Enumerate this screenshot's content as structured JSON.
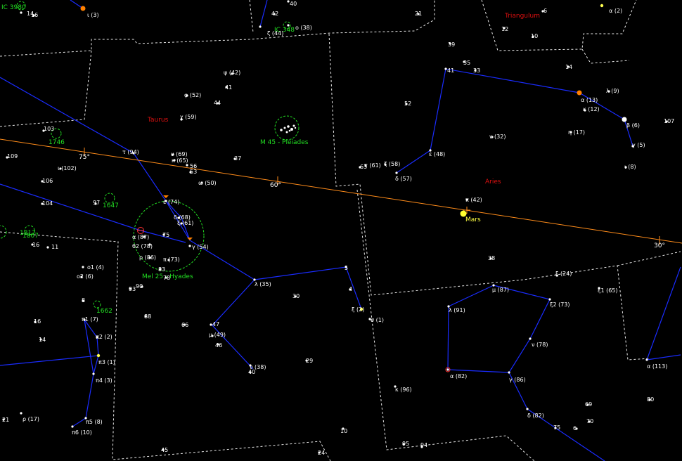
{
  "colors": {
    "background": "#000000",
    "constellation_line": "#1a2cff",
    "boundary": "#e8e8e8",
    "ecliptic": "#ff8c1a",
    "dso": "#22dd22",
    "constellation_name": "#e01010",
    "planet": "#ffff30",
    "star_label": "#ffffff"
  },
  "constellation_names": [
    "Taurus",
    "Aries",
    "Triangulum"
  ],
  "dso_labels": [
    "IC 348",
    "M 45 - Pleiades",
    "Mel 25 - Hyades",
    "1746",
    "1647",
    "1662",
    "1807",
    "1817",
    "IC 3980"
  ],
  "ecliptic_ticks": [
    "75°",
    "60°",
    "30°"
  ],
  "planet": {
    "name": "Mars",
    "icon": "planet-disc-icon"
  },
  "star_labels": [
    "ι (3)",
    "14",
    "16",
    "40",
    "42",
    "ζ (44)",
    "o (38)",
    "21",
    "6",
    "α (2)",
    "12",
    "10",
    "39",
    "35",
    "33",
    "41",
    "14",
    "ψ (42)",
    "41",
    "φ (52)",
    "44",
    "χ (59)",
    "52",
    "λ (9)",
    "α (13)",
    "κ (12)",
    "β (6)",
    "η (17)",
    "107",
    "γ (5)",
    "ι (8)",
    "ν (32)",
    "ε (48)",
    "ζ (58)",
    "τ (61)",
    "63",
    "δ (57)",
    "37",
    "υ (69)",
    "κ (65)",
    "56",
    "53",
    "ω (50)",
    "τ (94)",
    "103",
    "109",
    "ι (102)",
    "106",
    "104",
    "97",
    "π (42)",
    "ε (74)",
    "δ (68)",
    "ξ (61)",
    "75",
    "α (87)",
    "θ2 (78)",
    "γ (54)",
    "ρ (86)",
    "π (73)",
    "83",
    "78",
    "16",
    "11",
    "ο1 (4)",
    "ο2 (6)",
    "93",
    "90",
    "88",
    "66",
    "47",
    "μ (49)",
    "46",
    "λ (35)",
    "30",
    "5",
    "4",
    "ξ (2)",
    "σ (1)",
    "38",
    "ξ (24)",
    "μ (87)",
    "ξ2 (73)",
    "ξ1 (65)",
    "λ (91)",
    "ν (78)",
    "α (82)",
    "γ (86)",
    "δ (82)",
    "α (113)",
    "ν (38)",
    "40",
    "29",
    "κ (96)",
    "69",
    "70",
    "75",
    "80",
    "8",
    "16",
    "π1 (7)",
    "π2 (2)",
    "14",
    "π3 (1)",
    "π4 (3)",
    "π5 (8)",
    "π6 (10)",
    "ρ (17)",
    "21",
    "10",
    "95",
    "94",
    "24",
    "45",
    "6"
  ]
}
